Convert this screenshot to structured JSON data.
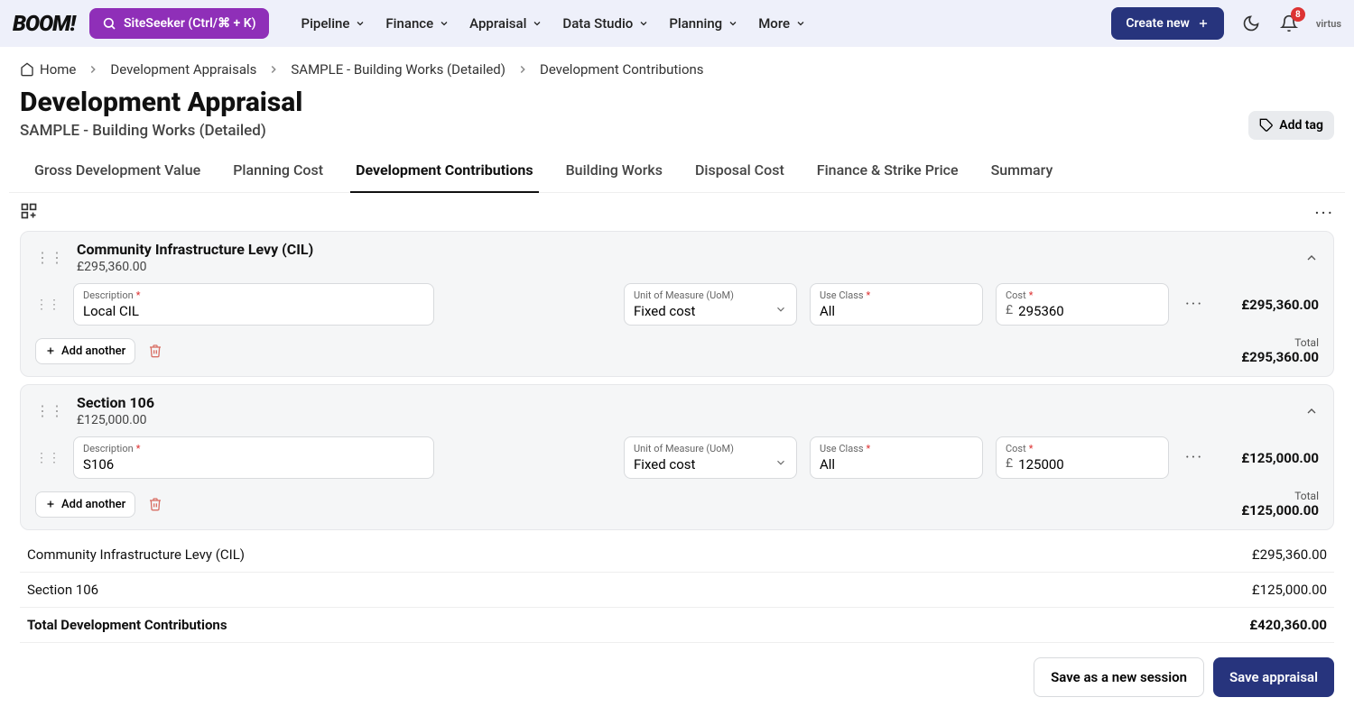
{
  "topbar": {
    "logo": "BOOM!",
    "siteseeker": "SiteSeeker (Ctrl/⌘ + K)",
    "nav": [
      "Pipeline",
      "Finance",
      "Appraisal",
      "Data Studio",
      "Planning",
      "More"
    ],
    "create": "Create new",
    "badge": "8",
    "user": "virtus"
  },
  "breadcrumb": [
    "Home",
    "Development Appraisals",
    "SAMPLE - Building Works (Detailed)",
    "Development Contributions"
  ],
  "header": {
    "title": "Development Appraisal",
    "subtitle": "SAMPLE - Building Works (Detailed)",
    "addTag": "Add tag"
  },
  "tabs": [
    "Gross Development Value",
    "Planning Cost",
    "Development Contributions",
    "Building Works",
    "Disposal Cost",
    "Finance & Strike Price",
    "Summary"
  ],
  "tabActiveIndex": 2,
  "fields": {
    "description": "Description",
    "uom": "Unit of Measure (UoM)",
    "useClass": "Use Class",
    "cost": "Cost",
    "currency": "£",
    "addAnother": "Add another",
    "totalLabel": "Total"
  },
  "groups": [
    {
      "title": "Community Infrastructure Levy (CIL)",
      "subAmount": "£295,360.00",
      "rows": [
        {
          "description": "Local CIL",
          "uom": "Fixed cost",
          "useClass": "All",
          "cost": "295360",
          "rowTotal": "£295,360.00"
        }
      ],
      "total": "£295,360.00"
    },
    {
      "title": "Section 106",
      "subAmount": "£125,000.00",
      "rows": [
        {
          "description": "S106",
          "uom": "Fixed cost",
          "useClass": "All",
          "cost": "125000",
          "rowTotal": "£125,000.00"
        }
      ],
      "total": "£125,000.00"
    }
  ],
  "summary": {
    "rows": [
      {
        "label": "Community Infrastructure Levy (CIL)",
        "value": "£295,360.00"
      },
      {
        "label": "Section 106",
        "value": "£125,000.00"
      }
    ],
    "totalLabel": "Total Development Contributions",
    "totalValue": "£420,360.00"
  },
  "footer": {
    "saveSession": "Save as a new session",
    "saveAppraisal": "Save appraisal"
  }
}
